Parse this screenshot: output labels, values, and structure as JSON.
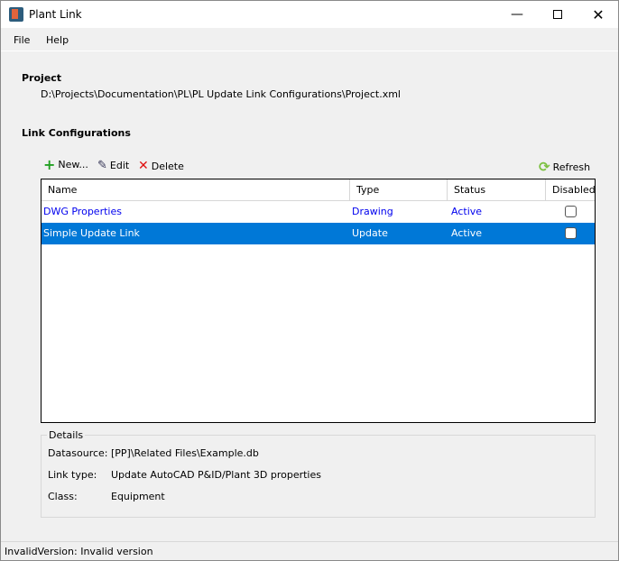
{
  "window": {
    "title": "Plant Link",
    "minimize_icon": "minimize-icon",
    "maximize_icon": "maximize-icon",
    "close_icon": "close-icon"
  },
  "menu": {
    "items": [
      {
        "label": "File"
      },
      {
        "label": "Help"
      }
    ]
  },
  "project": {
    "heading": "Project",
    "path": "D:\\Projects\\Documentation\\PL\\PL Update Link Configurations\\Project.xml"
  },
  "link_configs": {
    "heading": "Link Configurations",
    "toolbar": {
      "new_label": "New...",
      "edit_label": "Edit",
      "delete_label": "Delete",
      "refresh_label": "Refresh"
    },
    "columns": [
      "Name",
      "Type",
      "Status",
      "Disabled"
    ],
    "rows": [
      {
        "name": "DWG Properties",
        "type": "Drawing",
        "status": "Active",
        "disabled": false,
        "selected": false
      },
      {
        "name": "Simple Update Link",
        "type": "Update",
        "status": "Active",
        "disabled": false,
        "selected": true
      }
    ]
  },
  "details": {
    "heading": "Details",
    "datasource_label": "Datasource:",
    "datasource": "[PP]\\Related Files\\Example.db",
    "link_type_label": "Link type:",
    "link_type": "Update AutoCAD P&ID/Plant 3D properties",
    "class_label": "Class:",
    "class": "Equipment"
  },
  "status_bar": {
    "text": "InvalidVersion: Invalid version"
  },
  "colors": {
    "selection": "#0078d7",
    "link_text": "#0000ee",
    "add": "#22a022",
    "delete": "#e01010",
    "refresh": "#7cc040"
  }
}
